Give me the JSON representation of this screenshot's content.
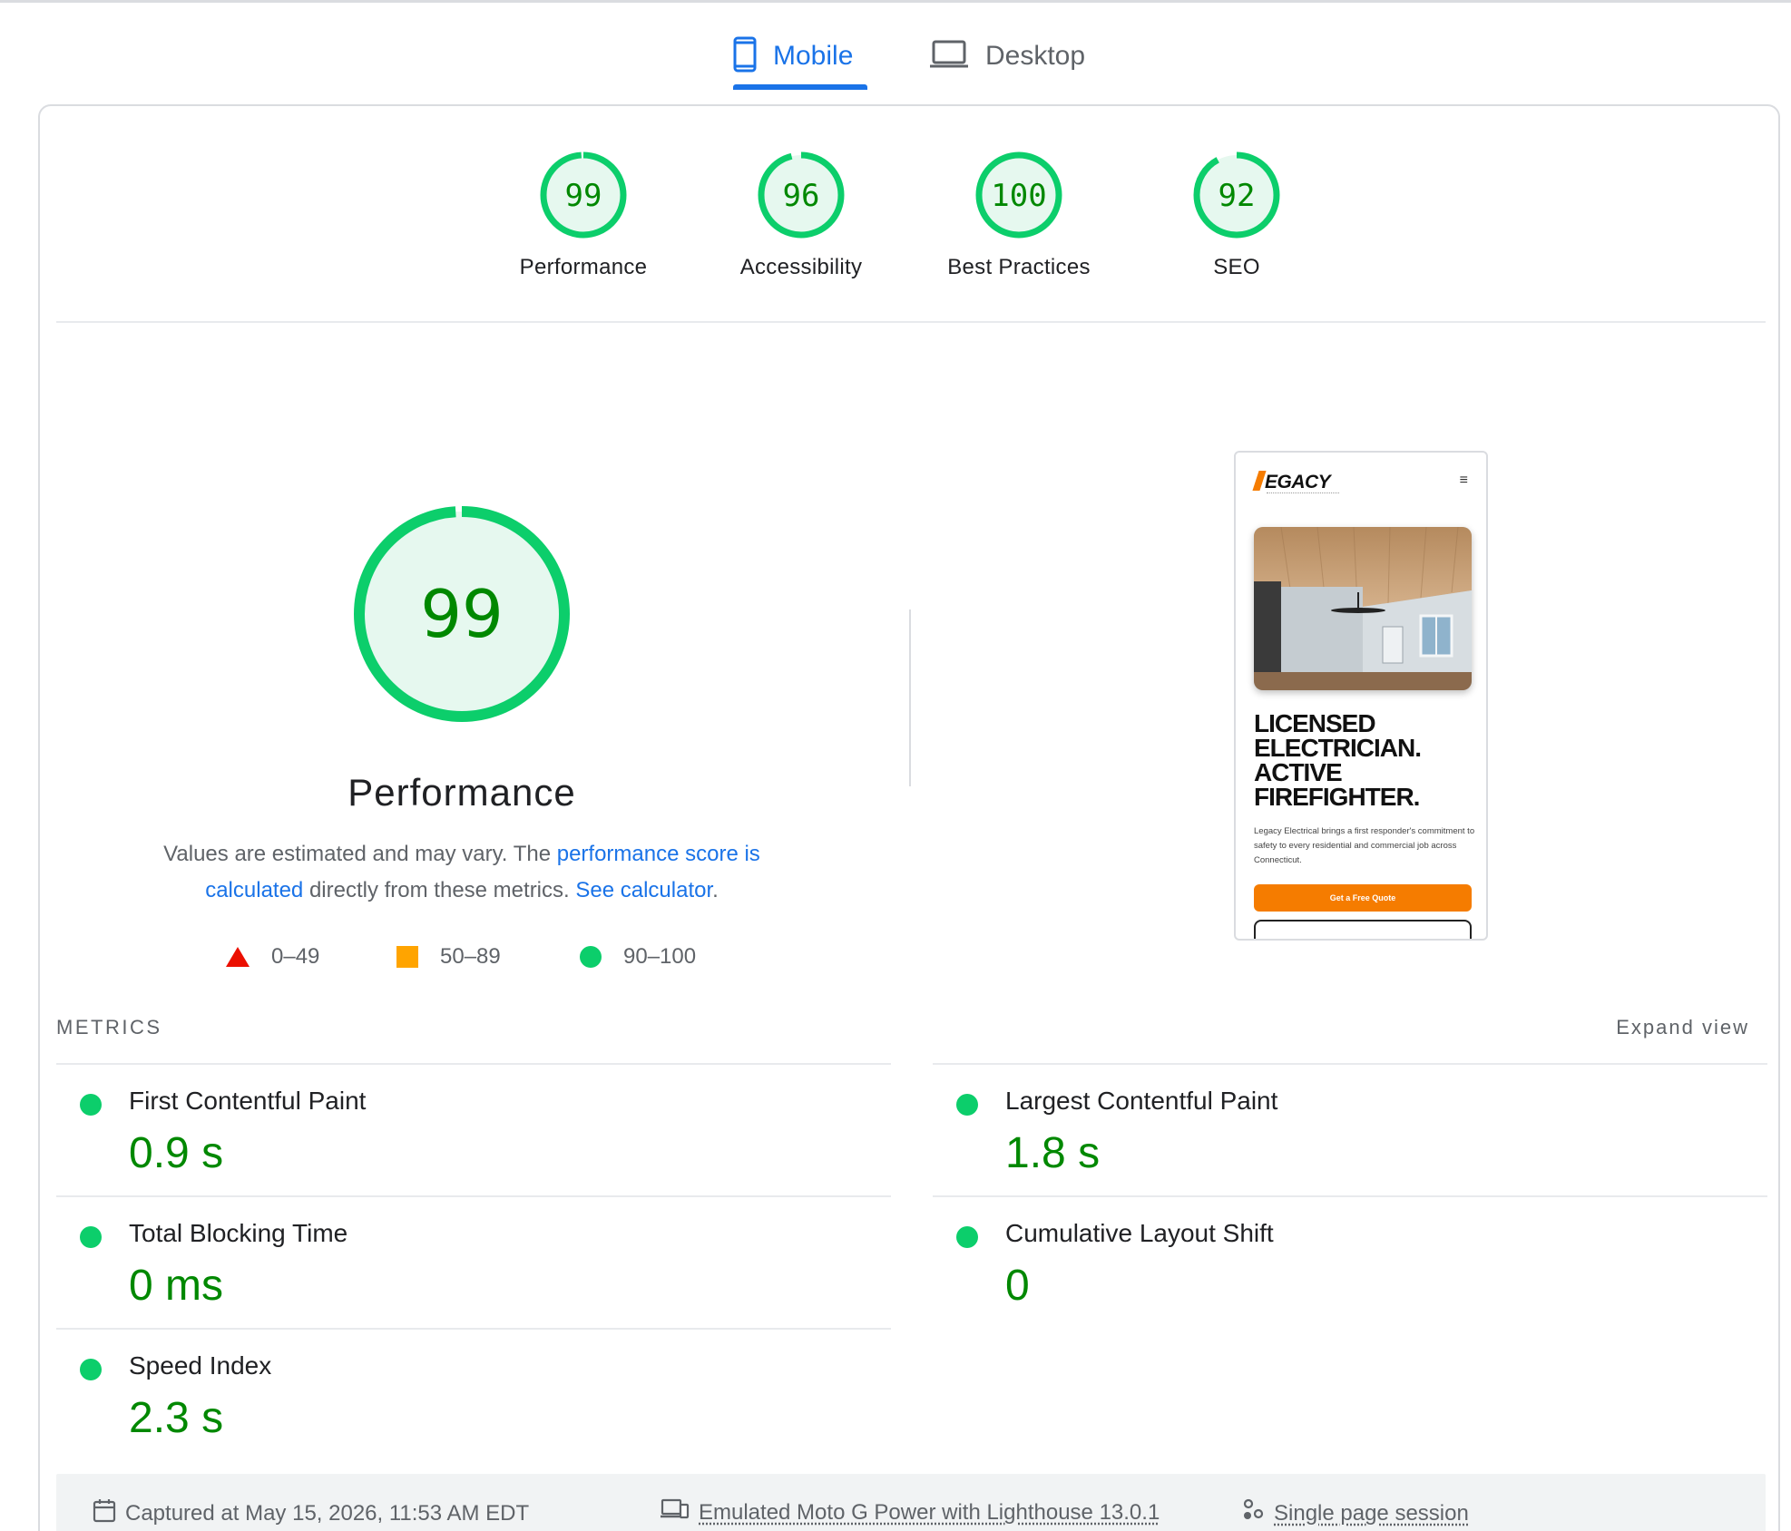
{
  "tabs": {
    "mobile_label": "Mobile",
    "desktop_label": "Desktop",
    "active": "Mobile"
  },
  "category_scores": [
    {
      "label": "Performance",
      "score": "99",
      "value": 99
    },
    {
      "label": "Accessibility",
      "score": "96",
      "value": 96
    },
    {
      "label": "Best Practices",
      "score": "100",
      "value": 100
    },
    {
      "label": "SEO",
      "score": "92",
      "value": 92
    }
  ],
  "performance": {
    "score": "99",
    "value": 99,
    "title": "Performance",
    "desc_prefix": "Values are estimated and may vary. The ",
    "desc_link1": "performance score is calculated",
    "desc_middle": " directly from these metrics. ",
    "desc_link2": "See calculator",
    "desc_suffix": "."
  },
  "legend": {
    "fail": "0–49",
    "average": "50–89",
    "pass": "90–100"
  },
  "screenshot": {
    "logo": "EGACY",
    "menu_glyph": "≡",
    "headline": "LICENSED ELECTRICIAN. ACTIVE FIREFIGHTER.",
    "body": "Legacy Electrical brings a first responder's commitment to safety to every residential and commercial job across Connecticut.",
    "cta": "Get a Free Quote"
  },
  "metrics": {
    "heading": "METRICS",
    "expand_label": "Expand view",
    "items": [
      {
        "title": "First Contentful Paint",
        "value": "0.9 s"
      },
      {
        "title": "Largest Contentful Paint",
        "value": "1.8 s"
      },
      {
        "title": "Total Blocking Time",
        "value": "0 ms"
      },
      {
        "title": "Cumulative Layout Shift",
        "value": "0"
      },
      {
        "title": "Speed Index",
        "value": "2.3 s"
      }
    ]
  },
  "footer": {
    "captured": "Captured at May 15, 2026, 11:53 AM EDT",
    "device": "Emulated Moto G Power with Lighthouse 13.0.1",
    "session": "Single page session"
  },
  "colors": {
    "accent": "#1a73e8",
    "pass": "#0cce6b",
    "pass_text": "#008800",
    "average": "#ffa400",
    "fail": "#eb0f00"
  }
}
